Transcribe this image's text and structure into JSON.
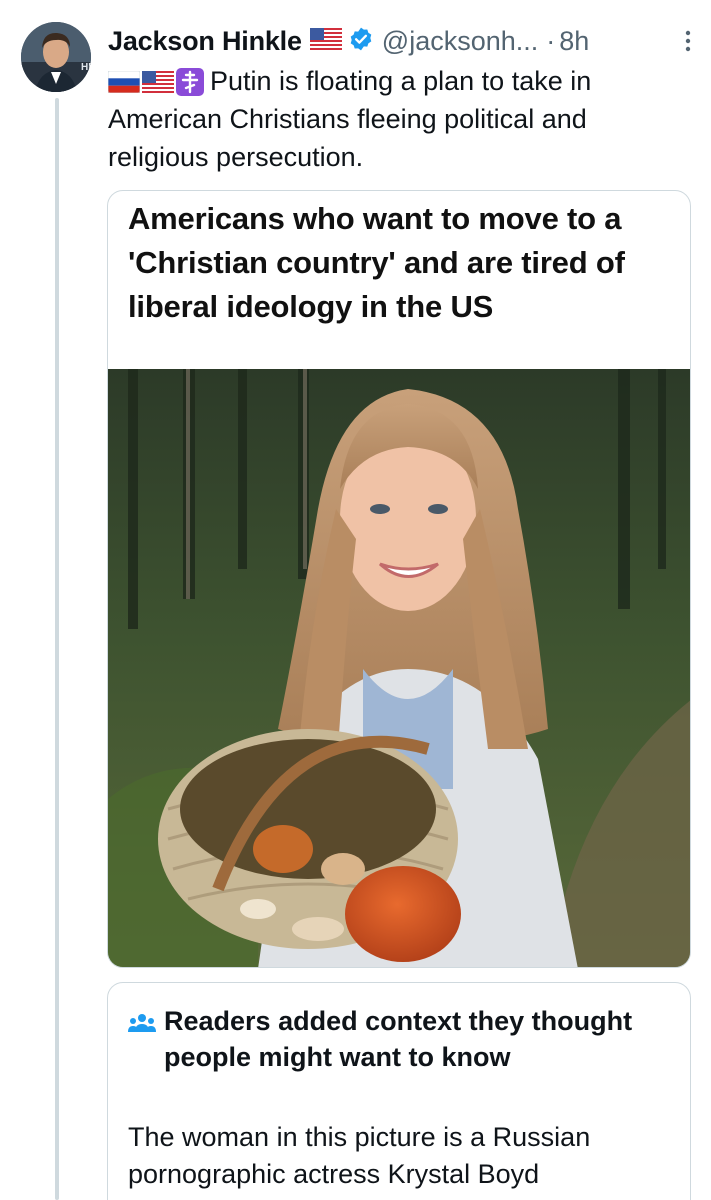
{
  "post": {
    "author_name": "Jackson Hinkle",
    "author_flag_icon": "us-flag-icon",
    "verified_icon": "verified-badge-icon",
    "handle": "@jacksonh...",
    "separator": "·",
    "time": "8h",
    "text": "Putin is floating a plan to take in American Christians fleeing political and religious persecution.",
    "text_prefix_icons": [
      "russia-flag-icon",
      "us-flag-icon",
      "orthodox-cross-icon"
    ]
  },
  "media_card": {
    "headline": "Americans who want to move to a 'Christian country' and are tired of liberal ideology in the US"
  },
  "community_note": {
    "icon": "readers-group-icon",
    "title": "Readers added context they thought people might want to know",
    "body": "The woman in this picture is a Russian pornographic actress Krystal Boyd"
  },
  "colors": {
    "text": "#0f1419",
    "secondary": "#536471",
    "verified": "#1d9bf0",
    "border": "#cfd9de"
  }
}
